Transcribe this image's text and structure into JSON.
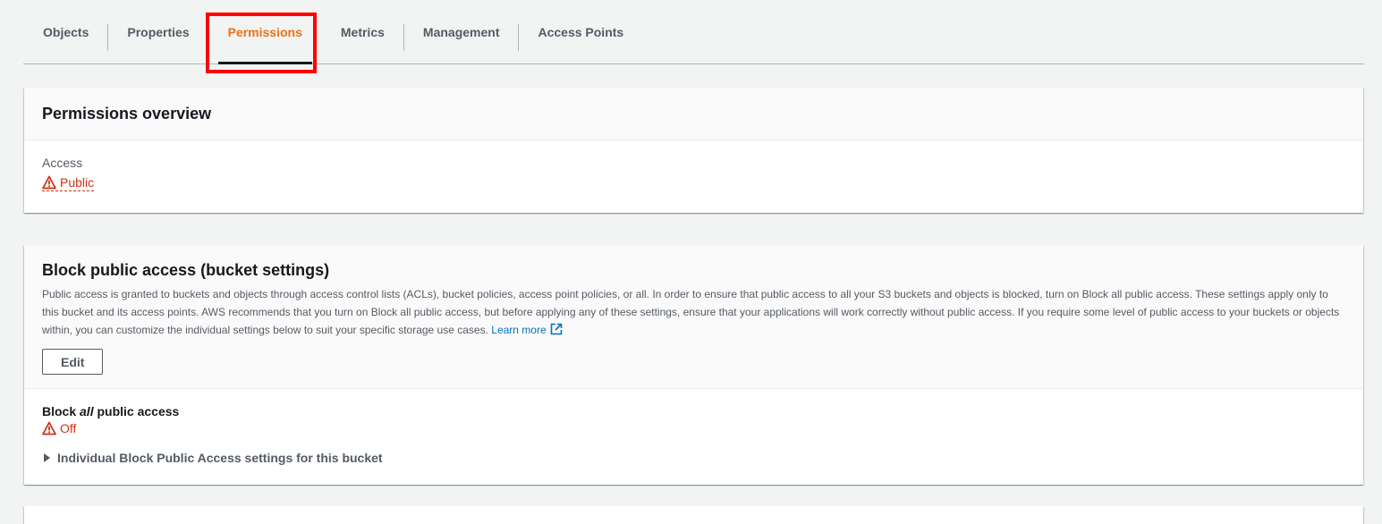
{
  "tabs": [
    {
      "label": "Objects",
      "active": false
    },
    {
      "label": "Properties",
      "active": false
    },
    {
      "label": "Permissions",
      "active": true
    },
    {
      "label": "Metrics",
      "active": false
    },
    {
      "label": "Management",
      "active": false
    },
    {
      "label": "Access Points",
      "active": false
    }
  ],
  "overview": {
    "title": "Permissions overview",
    "access_label": "Access",
    "access_value": "Public"
  },
  "block_public_access": {
    "title": "Block public access (bucket settings)",
    "description": "Public access is granted to buckets and objects through access control lists (ACLs), bucket policies, access point policies, or all. In order to ensure that public access to all your S3 buckets and objects is blocked, turn on Block all public access. These settings apply only to this bucket and its access points. AWS recommends that you turn on Block all public access, but before applying any of these settings, ensure that your applications will work correctly without public access. If you require some level of public access to your buckets or objects within, you can customize the individual settings below to suit your specific storage use cases.",
    "learn_more": "Learn more",
    "edit_label": "Edit",
    "block_all_prefix": "Block ",
    "block_all_em": "all",
    "block_all_suffix": " public access",
    "status": "Off",
    "individual_settings": "Individual Block Public Access settings for this bucket"
  },
  "colors": {
    "accent": "#ec7211",
    "warning": "#d13212",
    "link": "#0073bb",
    "highlight": "#ff0000"
  }
}
